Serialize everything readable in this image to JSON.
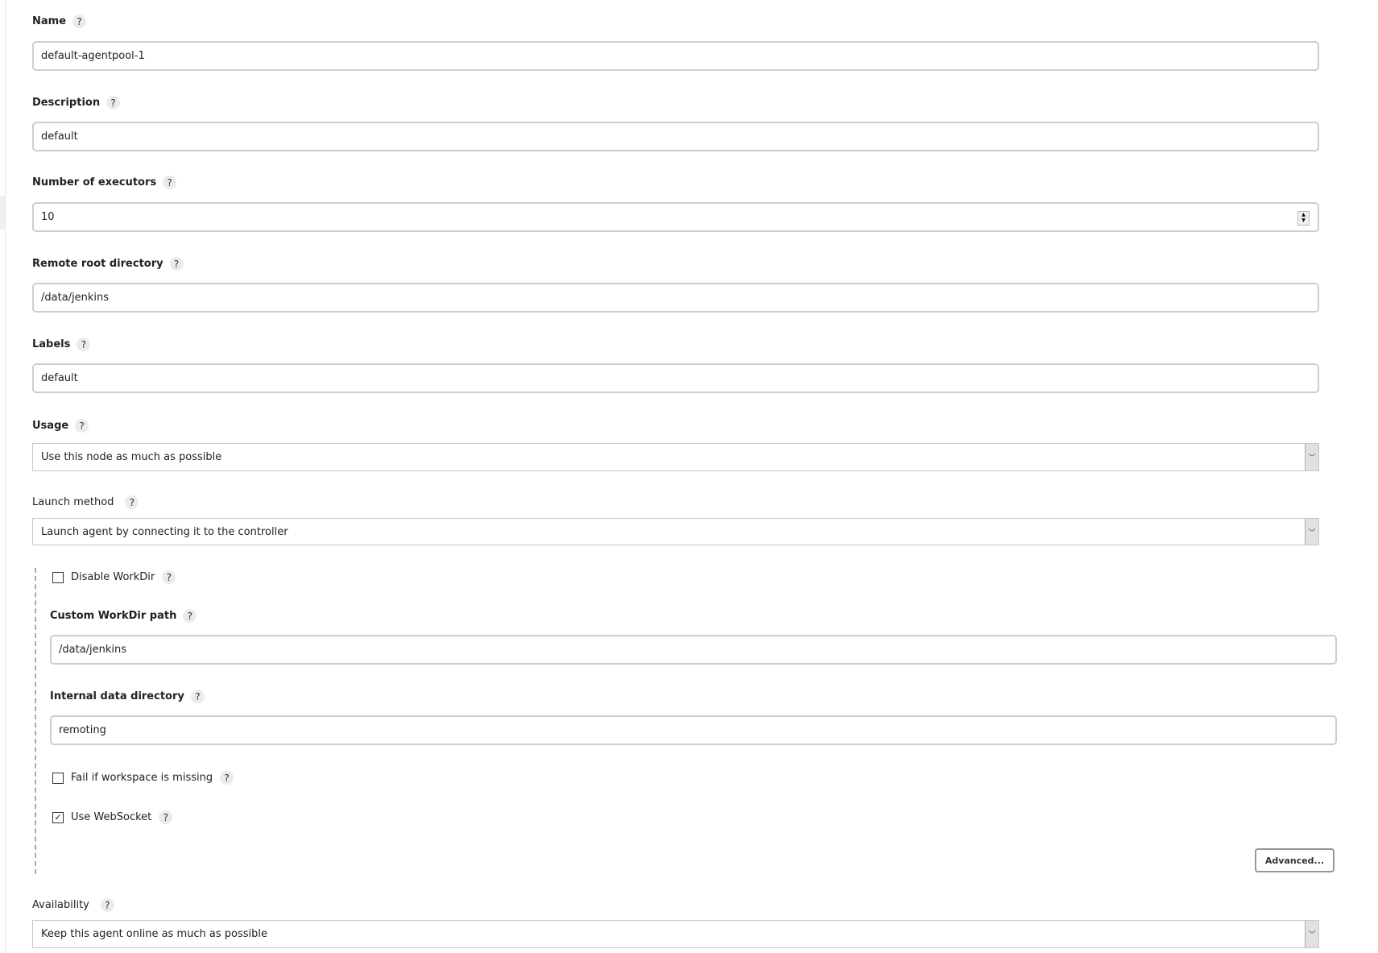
{
  "fields": {
    "name": {
      "label": "Name",
      "value": "default-agentpool-1"
    },
    "description": {
      "label": "Description",
      "value": "default"
    },
    "executors": {
      "label": "Number of executors",
      "value": "10"
    },
    "remote_root": {
      "label": "Remote root directory",
      "value": "/data/jenkins"
    },
    "labels": {
      "label": "Labels",
      "value": "default"
    },
    "usage": {
      "label": "Usage",
      "selected": "Use this node as much as possible"
    },
    "launch_method": {
      "label": "Launch method",
      "selected": "Launch agent by connecting it to the controller"
    },
    "disable_workdir": {
      "label": "Disable WorkDir",
      "checked": false
    },
    "custom_workdir": {
      "label": "Custom WorkDir path",
      "value": "/data/jenkins"
    },
    "internal_dir": {
      "label": "Internal data directory",
      "value": "remoting"
    },
    "fail_missing": {
      "label": "Fail if workspace is missing",
      "checked": false
    },
    "websocket": {
      "label": "Use WebSocket",
      "checked": true
    },
    "availability": {
      "label": "Availability",
      "selected": "Keep this agent online as much as possible"
    }
  },
  "help_glyph": "?",
  "check_glyph": "✓",
  "advanced_button": "Advanced...",
  "icons": {
    "help": "question-circle-icon",
    "dropdown": "chevron-down-icon",
    "spinner": "number-spinner-icon"
  }
}
